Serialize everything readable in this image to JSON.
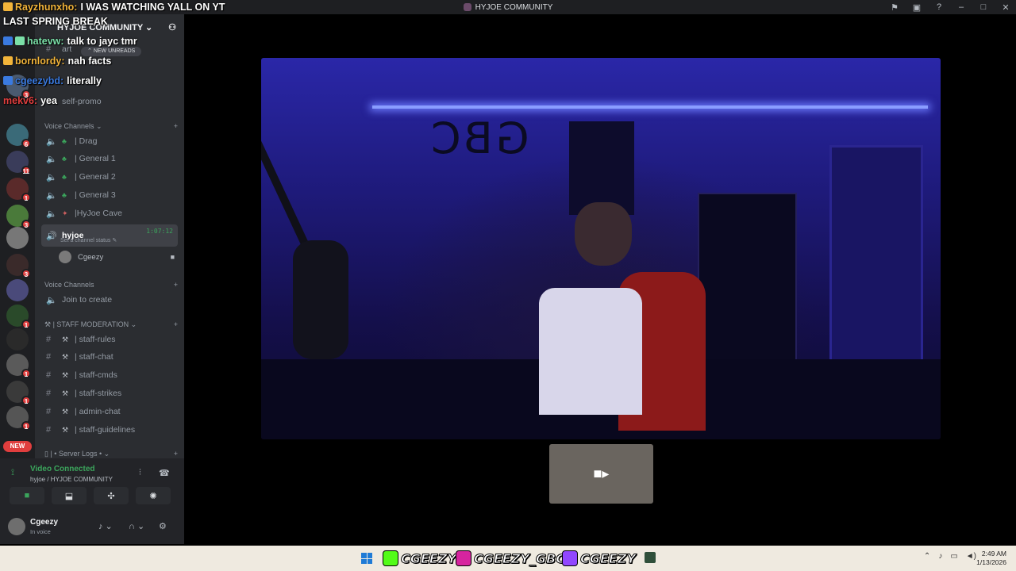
{
  "window": {
    "title": "HYJOE COMMUNITY"
  },
  "server_rail": {
    "badges": [
      "3",
      "6",
      "11",
      "1",
      "3",
      "3",
      "1",
      "1",
      "1",
      "1"
    ],
    "new_label": "NEW"
  },
  "sidebar": {
    "server_name": "HYJOE COMMUNITY",
    "new_unreads": "NEW UNREADS",
    "top_channels": [
      "art",
      "self-promo"
    ],
    "voice_category": "Voice Channels",
    "voice_channels": [
      "| Drag",
      "| General 1",
      "| General 2",
      "| General 3",
      "|HyJoe Cave"
    ],
    "active_channel": {
      "name": "hyjoe",
      "status": "Set a channel status",
      "time": "1:07:12"
    },
    "voice_user": "Cgeezy",
    "voice_category2": "Voice Channels",
    "join_create": "Join to create",
    "staff_category": "| STAFF MODERATION",
    "staff_channels": [
      "| staff-rules",
      "|  staff-chat",
      "| staff-cmds",
      "| staff-strikes",
      "| admin-chat",
      "| staff-guidelines"
    ],
    "logs_category": "| • Server Logs •"
  },
  "user_panel": {
    "vc_title": "Video Connected",
    "vc_sub": "hyjoe / HYJOE COMMUNITY",
    "username": "Cgeezy",
    "status": "In voice"
  },
  "chat": [
    {
      "user": "Rayzhunxho:",
      "text": "I WAS WATCHING YALL ON YT",
      "color": "#f2b43a"
    },
    {
      "user": "",
      "text": "LAST SPRING BREAK",
      "color": "#ffffff"
    },
    {
      "user": "hatevw:",
      "text": "talk to jayc tmr",
      "color": "#7be0a8"
    },
    {
      "user": "bornlordy:",
      "text": "nah facts",
      "color": "#f2b43a"
    },
    {
      "user": "cgeezybd:",
      "text": "literally",
      "color": "#3a7ae0"
    },
    {
      "user": "mekv6:",
      "text": "yea",
      "color": "#e03e3e"
    }
  ],
  "taskbar": {
    "kick": "CGEEZY",
    "instagram": "CGEEZY_GBC",
    "twitch": "CGEEZY",
    "time": "2:49 AM",
    "date": "1/13/2026"
  },
  "colors": {
    "accent_green": "#3ba55c",
    "badge_red": "#e03e3e",
    "sidebar": "#2b2d31",
    "rail": "#1e1f22"
  }
}
